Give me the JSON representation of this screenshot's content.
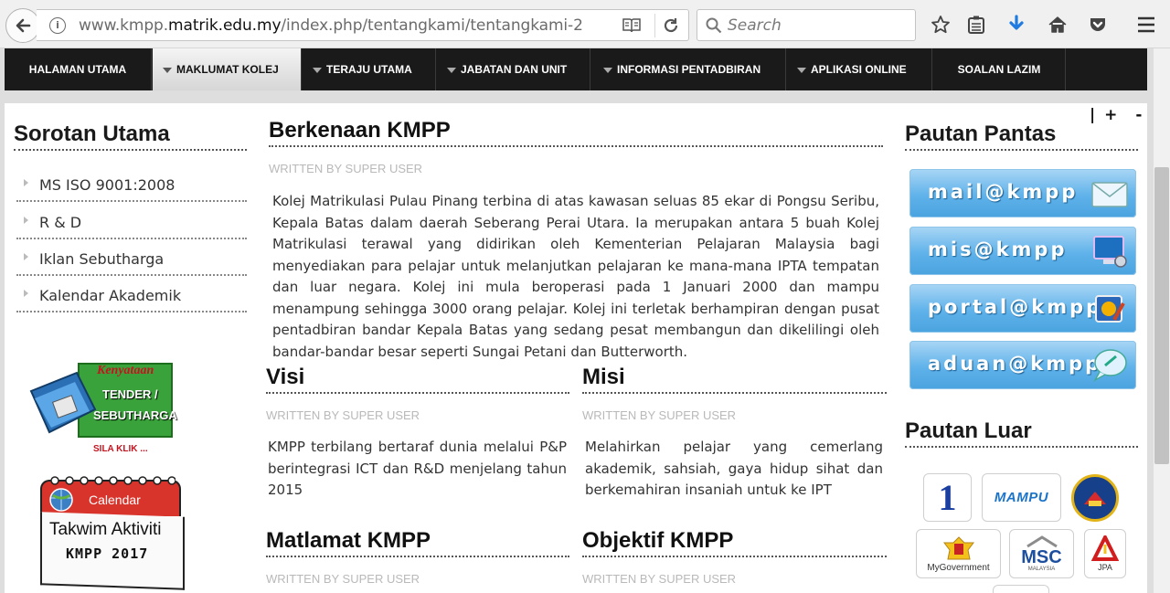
{
  "browser": {
    "url_host_prefix": "www.kmpp.",
    "url_host_main": "matrik.edu.my",
    "url_path": "/index.php/tentangkami/tentangkami-2",
    "search_placeholder": "Search",
    "icons": [
      "back-icon",
      "info-icon",
      "reader-view-icon",
      "reload-icon",
      "search-icon",
      "bookmark-star-icon",
      "reading-list-icon",
      "download-arrow-icon",
      "home-icon",
      "pocket-icon",
      "hamburger-menu-icon"
    ]
  },
  "nav": {
    "items": [
      {
        "label": "HALAMAN UTAMA",
        "dropdown": false,
        "active": false
      },
      {
        "label": "MAKLUMAT KOLEJ",
        "dropdown": true,
        "active": true
      },
      {
        "label": "TERAJU UTAMA",
        "dropdown": true,
        "active": false
      },
      {
        "label": "JABATAN DAN UNIT",
        "dropdown": true,
        "active": false
      },
      {
        "label": "INFORMASI PENTADBIRAN",
        "dropdown": true,
        "active": false
      },
      {
        "label": "APLIKASI ONLINE",
        "dropdown": true,
        "active": false
      },
      {
        "label": "SOALAN LAZIM",
        "dropdown": false,
        "active": false
      }
    ]
  },
  "left": {
    "title": "Sorotan Utama",
    "links": [
      "MS ISO 9001:2008",
      "R & D",
      "Iklan Sebutharga",
      "Kalendar Akademik"
    ],
    "banner1": {
      "line1": "Kenyataan",
      "line2": "TENDER /",
      "line3": "SEBUTHARGA",
      "line4": "SILA KLIK ..."
    },
    "banner2": {
      "line1": "Calendar",
      "line2": "Takwim Aktiviti",
      "line3": "KMPP 2017"
    }
  },
  "center": {
    "font_controls": {
      "sep": "|",
      "plus": "+",
      "minus": "-"
    },
    "main": {
      "title": "Berkenaan KMPP",
      "written": "WRITTEN BY SUPER USER",
      "body": "Kolej Matrikulasi Pulau Pinang terbina di atas kawasan seluas 85 ekar di Pongsu Seribu, Kepala Batas dalam daerah Seberang Perai Utara. Ia merupakan antara 5 buah Kolej Matrikulasi terawal yang didirikan oleh Kementerian Pelajaran Malaysia bagi menyediakan para pelajar untuk melanjutkan pelajaran ke mana-mana IPTA tempatan dan luar negara. Kolej ini mula beroperasi pada 1 Januari 2000 dan mampu menampung sehingga 3000 orang pelajar. Kolej ini terletak berhampiran dengan pusat pentadbiran bandar Kepala Batas yang sedang pesat membangun dan dikelilingi oleh bandar-bandar besar seperti Sungai Petani dan Butterworth."
    },
    "visi": {
      "title": "Visi",
      "written": "WRITTEN BY SUPER USER",
      "body": "KMPP terbilang bertaraf dunia melalui P&P berintegrasi ICT dan R&D menjelang tahun 2015"
    },
    "misi": {
      "title": "Misi",
      "written": "WRITTEN BY SUPER USER",
      "body": "Melahirkan pelajar yang cemerlang akademik, sahsiah, gaya hidup sihat dan berkemahiran insaniah untuk ke IPT"
    },
    "matlamat": {
      "title": "Matlamat KMPP",
      "written": "WRITTEN BY SUPER USER"
    },
    "objektif": {
      "title": "Objektif KMPP",
      "written": "WRITTEN BY SUPER USER"
    }
  },
  "right": {
    "pantas_title": "Pautan Pantas",
    "quick_links": [
      "mail@kmpp",
      "mis@kmpp",
      "portal@kmpp",
      "aduan@kmpp"
    ],
    "luar_title": "Pautan Luar",
    "logos": {
      "one": "1",
      "mampu": "MAMPU",
      "mygov": "MyGovernment",
      "msc": "MSC",
      "msc_sub": "MALAYSIA",
      "jpa": "JPA"
    }
  }
}
